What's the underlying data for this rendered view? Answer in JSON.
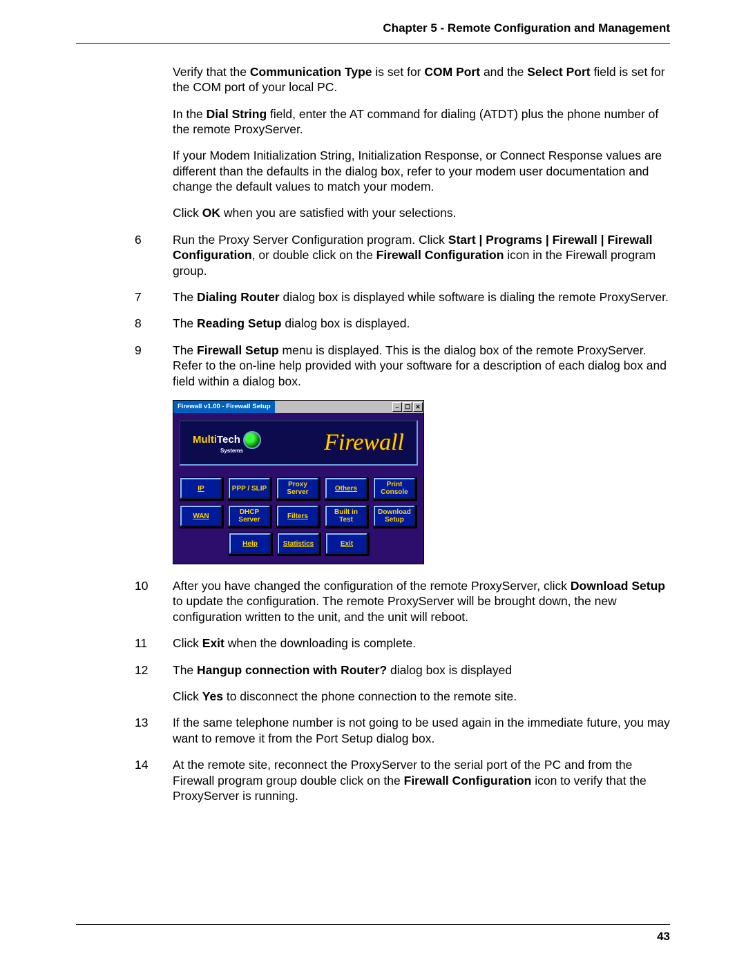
{
  "header": "Chapter 5 - Remote Configuration and Management",
  "page_number": "43",
  "p1": {
    "t1": "Verify that the ",
    "b1": "Communication Type",
    "t2": " is set for ",
    "b2": "COM Port",
    "t3": " and the ",
    "b3": "Select Port",
    "t4": " field is set for the COM port of your local PC."
  },
  "p2": {
    "t1": "In the ",
    "b1": "Dial String",
    "t2": " field, enter the AT command for dialing (ATDT) plus the phone number of the remote ProxyServer."
  },
  "p3": "If your Modem Initialization String, Initialization Response, or Connect Response values are different than the defaults in the dialog box, refer to your modem user documentation and change the default values to match your modem.",
  "p4": {
    "t1": "Click ",
    "b1": "OK",
    "t2": " when you are satisfied with your selections."
  },
  "s6": {
    "n": "6",
    "t1": "Run the Proxy Server Configuration program. Click ",
    "b1": "Start | Programs | Firewall | Firewall Configuration",
    "t2": ", or double click on the ",
    "b2": "Firewall Configuration",
    "t3": " icon in the Firewall program group."
  },
  "s7": {
    "n": "7",
    "t1": "The ",
    "b1": "Dialing Router",
    "t2": " dialog box is displayed while software is dialing the remote ProxyServer."
  },
  "s8": {
    "n": "8",
    "t1": "The ",
    "b1": "Reading Setup",
    "t2": " dialog box is displayed."
  },
  "s9": {
    "n": "9",
    "t1": "The ",
    "b1": "Firewall Setup",
    "t2": " menu is displayed. This is the dialog box of the remote ProxyServer. Refer to the on-line help provided with your software for a description of each dialog box and field within a dialog box."
  },
  "s10": {
    "n": "10",
    "t1": "After you have changed the configuration of the remote ProxyServer, click ",
    "b1": "Download Setup",
    "t2": " to update the configuration. The remote ProxyServer will be brought down, the new configuration written to the unit, and the unit will reboot."
  },
  "s11": {
    "n": "11",
    "t1": "Click ",
    "b1": "Exit",
    "t2": " when the downloading is complete."
  },
  "s12": {
    "n": "12",
    "t1": "The ",
    "b1": "Hangup connection with Router?",
    "t2": " dialog box is displayed",
    "p2t1": "Click ",
    "p2b1": "Yes",
    "p2t2": " to disconnect the phone connection to the remote site."
  },
  "s13": {
    "n": "13",
    "t": "If the same telephone number is not going to be used again in the immediate future, you may want to remove it from the Port Setup dialog box."
  },
  "s14": {
    "n": "14",
    "t1": "At the remote site, reconnect the ProxyServer to the serial port of the PC and from the Firewall program group double click on the ",
    "b1": "Firewall Configuration",
    "t2": " icon to verify that the ProxyServer is running."
  },
  "dialog": {
    "title": "Firewall v1.00 - Firewall Setup",
    "brand_a": "Multi",
    "brand_b": "Tech",
    "brand_sub": "Systems",
    "banner_right": "Firewall",
    "row1": [
      "IP",
      "PPP / SLIP",
      "Proxy Server",
      "Others",
      "Print Console"
    ],
    "row2": [
      "WAN",
      "DHCP Server",
      "Filters",
      "Built in Test",
      "Download Setup"
    ],
    "row3": [
      "Help",
      "Statistics",
      "Exit"
    ]
  }
}
